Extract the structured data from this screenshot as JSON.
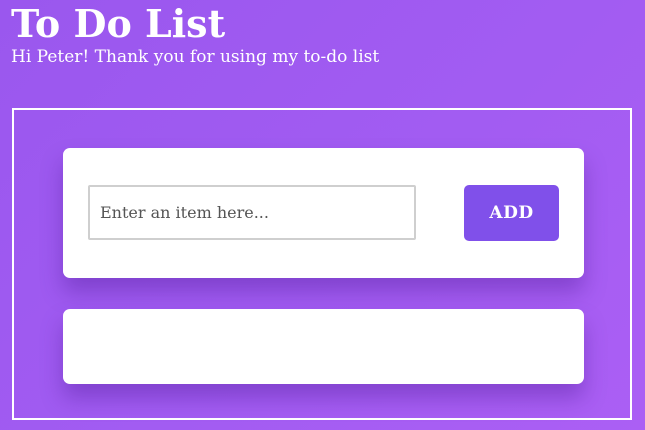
{
  "header": {
    "title": "To Do List",
    "subtitle": "Hi Peter! Thank you for using my to-do list"
  },
  "form": {
    "input_value": "",
    "input_placeholder": "Enter an item here...",
    "add_label": "ADD"
  },
  "todo_list": {
    "items": []
  },
  "colors": {
    "background_gradient_start": "#9a57ee",
    "background_gradient_end": "#ab5ff4",
    "button": "#8050ea",
    "card": "#ffffff"
  }
}
